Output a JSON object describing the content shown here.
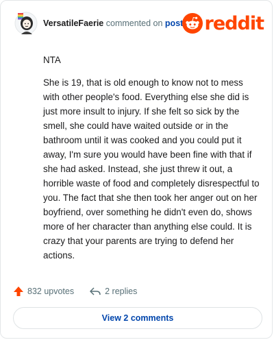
{
  "comment": {
    "username": "VersatileFaerie",
    "action_text": "commented on",
    "post_link_text": "post",
    "paragraphs": [
      "NTA",
      "She is 19, that is old enough to know not to mess with other people's food. Everything else she did is just more insult to injury. If she felt so sick by the smell, she could have waited outside or in the bathroom until it was cooked and you could put it away, I'm sure you would have been fine with that if she had asked. Instead, she just threw it out, a horrible waste of food and completely disrespectful to you. The fact that she then took her anger out on her boyfriend, over something he didn't even do, shows more of her character than anything else could. It is crazy that your parents are trying to defend her actions."
    ]
  },
  "brand": {
    "wordmark": "reddit",
    "icon": "reddit-snoo-icon",
    "color": "#ff4500"
  },
  "footer": {
    "upvotes_label": "832 upvotes",
    "replies_label": "2 replies",
    "upvote_icon": "upvote-arrow-icon",
    "reply_icon": "reply-arrow-icon",
    "upvote_color": "#ff4500"
  },
  "view_comments_label": "View 2 comments",
  "colors": {
    "link": "#0045ac",
    "muted": "#576f76",
    "text": "#1a1a1b"
  }
}
